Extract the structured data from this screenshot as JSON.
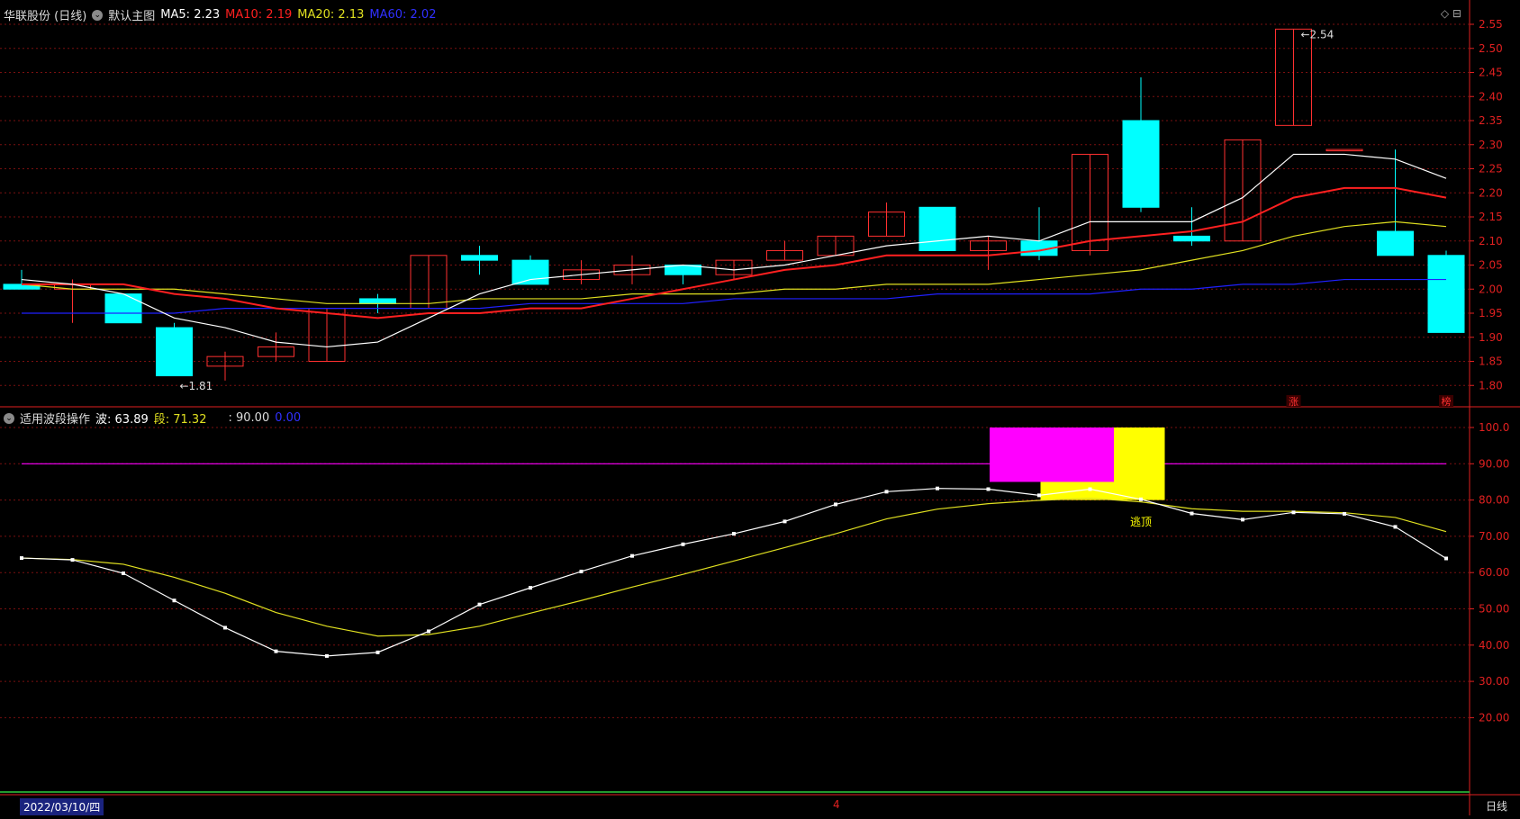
{
  "main_header": {
    "stock": "华联股份 (日线)",
    "chart_name": "默认主图",
    "ma5": "MA5: 2.23",
    "ma10": "MA10: 2.19",
    "ma20": "MA20: 2.13",
    "ma60": "MA60: 2.02"
  },
  "sub_header": {
    "indicator": "适用波段操作",
    "wave": "波: 63.89",
    "segment": "段: 71.32",
    "level": ": 90.00",
    "level2": "0.00"
  },
  "colors": {
    "up": "#ff3030",
    "down": "#00ffff",
    "ma5": "#ffffff",
    "ma10": "#ff2020",
    "ma20": "#e0e020",
    "ma60": "#2020ff",
    "grid": "#7a1010",
    "axis": "#e02020",
    "magenta": "#ff00ff",
    "yellow": "#ffff00"
  },
  "main_axis_labels": [
    "2.55",
    "2.50",
    "2.45",
    "2.40",
    "2.35",
    "2.30",
    "2.25",
    "2.20",
    "2.15",
    "2.10",
    "2.05",
    "2.00",
    "1.95",
    "1.90",
    "1.85",
    "1.80"
  ],
  "sub_axis_labels": [
    "100.0",
    "90.00",
    "80.00",
    "70.00",
    "60.00",
    "50.00",
    "40.00",
    "30.00",
    "20.00"
  ],
  "annotations": {
    "high": "2.54",
    "low": "1.81",
    "escape_top": "逃顶",
    "badge1": "涨",
    "badge2": "榜"
  },
  "footer": {
    "date": "2022/03/10/四",
    "month": "4",
    "period": "日线"
  },
  "window_icons": "◇ ⊟",
  "chart_data": [
    {
      "type": "candlestick",
      "title": "华联股份 (日线)",
      "ylim": [
        1.78,
        2.57
      ],
      "ohlc": [
        [
          2.01,
          2.04,
          2.0,
          2.0
        ],
        [
          2.0,
          2.02,
          1.93,
          2.01
        ],
        [
          1.99,
          1.99,
          1.93,
          1.93
        ],
        [
          1.92,
          1.93,
          1.82,
          1.82
        ],
        [
          1.84,
          1.87,
          1.81,
          1.86
        ],
        [
          1.86,
          1.91,
          1.85,
          1.88
        ],
        [
          1.85,
          1.96,
          1.85,
          1.96
        ],
        [
          1.98,
          1.99,
          1.95,
          1.97
        ],
        [
          1.96,
          2.07,
          1.96,
          2.07
        ],
        [
          2.07,
          2.09,
          2.03,
          2.06
        ],
        [
          2.06,
          2.07,
          2.01,
          2.01
        ],
        [
          2.02,
          2.06,
          2.01,
          2.04
        ],
        [
          2.03,
          2.07,
          2.01,
          2.05
        ],
        [
          2.05,
          2.05,
          2.01,
          2.03
        ],
        [
          2.03,
          2.06,
          2.02,
          2.06
        ],
        [
          2.06,
          2.1,
          2.06,
          2.08
        ],
        [
          2.07,
          2.11,
          2.07,
          2.11
        ],
        [
          2.11,
          2.18,
          2.11,
          2.16
        ],
        [
          2.17,
          2.17,
          2.08,
          2.08
        ],
        [
          2.08,
          2.11,
          2.04,
          2.1
        ],
        [
          2.1,
          2.17,
          2.06,
          2.07
        ],
        [
          2.08,
          2.28,
          2.07,
          2.28
        ],
        [
          2.35,
          2.44,
          2.16,
          2.17
        ],
        [
          2.11,
          2.17,
          2.09,
          2.1
        ],
        [
          2.1,
          2.31,
          2.1,
          2.31
        ],
        [
          2.34,
          2.54,
          2.34,
          2.54
        ],
        [
          2.29,
          2.29,
          2.29,
          2.29
        ],
        [
          2.12,
          2.29,
          2.07,
          2.07
        ],
        [
          2.07,
          2.08,
          1.91,
          1.91
        ]
      ],
      "ma5": [
        2.02,
        2.01,
        1.99,
        1.94,
        1.92,
        1.89,
        1.88,
        1.89,
        1.94,
        1.99,
        2.02,
        2.03,
        2.04,
        2.05,
        2.04,
        2.05,
        2.07,
        2.09,
        2.1,
        2.11,
        2.1,
        2.14,
        2.14,
        2.14,
        2.19,
        2.28,
        2.28,
        2.27,
        2.23
      ],
      "ma10": [
        2.01,
        2.01,
        2.01,
        1.99,
        1.98,
        1.96,
        1.95,
        1.94,
        1.95,
        1.95,
        1.96,
        1.96,
        1.98,
        2.0,
        2.02,
        2.04,
        2.05,
        2.07,
        2.07,
        2.07,
        2.08,
        2.1,
        2.11,
        2.12,
        2.14,
        2.19,
        2.21,
        2.21,
        2.19
      ],
      "ma20": [
        2.01,
        2.0,
        2.0,
        2.0,
        1.99,
        1.98,
        1.97,
        1.97,
        1.97,
        1.98,
        1.98,
        1.98,
        1.99,
        1.99,
        1.99,
        2.0,
        2.0,
        2.01,
        2.01,
        2.01,
        2.02,
        2.03,
        2.04,
        2.06,
        2.08,
        2.11,
        2.13,
        2.14,
        2.13
      ],
      "ma60": [
        1.95,
        1.95,
        1.95,
        1.95,
        1.96,
        1.96,
        1.96,
        1.96,
        1.96,
        1.96,
        1.97,
        1.97,
        1.97,
        1.97,
        1.98,
        1.98,
        1.98,
        1.98,
        1.99,
        1.99,
        1.99,
        1.99,
        2.0,
        2.0,
        2.01,
        2.01,
        2.02,
        2.02,
        2.02
      ]
    },
    {
      "type": "line",
      "title": "适用波段操作",
      "ylim": [
        0,
        105
      ],
      "series": [
        {
          "name": "波",
          "values": [
            64.0,
            63.5,
            59.8,
            52.3,
            44.8,
            38.3,
            37.0,
            38.0,
            43.8,
            51.2,
            55.8,
            60.3,
            64.6,
            67.8,
            70.7,
            74.1,
            78.8,
            82.3,
            83.2,
            83.0,
            81.3,
            83.0,
            80.2,
            76.3,
            74.6,
            76.6,
            76.2,
            72.6,
            63.9
          ]
        },
        {
          "name": "段",
          "values": [
            64.0,
            63.6,
            62.3,
            58.7,
            54.3,
            49.0,
            45.2,
            42.5,
            42.9,
            45.2,
            48.8,
            52.3,
            56.0,
            59.5,
            63.2,
            66.9,
            70.7,
            74.8,
            77.5,
            79.0,
            79.9,
            80.5,
            79.5,
            77.6,
            76.9,
            76.9,
            76.5,
            75.2,
            71.3
          ]
        }
      ],
      "reference_line": 90
    }
  ]
}
